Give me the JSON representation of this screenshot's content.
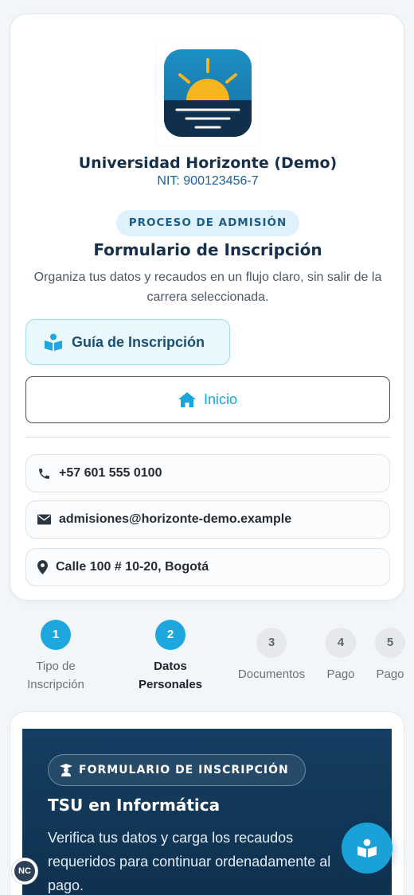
{
  "colors": {
    "accent": "#1da7de",
    "navy": "#17304a",
    "hero_bg": "#0f2f4d"
  },
  "header": {
    "university_name": "Universidad Horizonte (Demo)",
    "nit": "NIT: 900123456-7",
    "badge": "PROCESO DE ADMISIÓN",
    "form_title": "Formulario de Inscripción",
    "form_subtitle": "Organiza tus datos y recaudos en un flujo claro, sin salir de la carrera seleccionada."
  },
  "actions": {
    "guide_label": "Guía de Inscripción",
    "guide_icon": "book-reader-icon",
    "home_label": "Inicio",
    "home_icon": "home-icon"
  },
  "contact": [
    {
      "icon": "phone-icon",
      "text": "+57 601 555 0100"
    },
    {
      "icon": "envelope-icon",
      "text": "admisiones@horizonte-demo.example"
    },
    {
      "icon": "map-pin-icon",
      "text": "Calle 100 # 10-20, Bogotá"
    }
  ],
  "steps": [
    {
      "number": "1",
      "label": "Tipo de Inscripción",
      "state": "done"
    },
    {
      "number": "2",
      "label": "Datos Personales",
      "state": "current"
    },
    {
      "number": "3",
      "label": "Documentos",
      "state": "pending"
    },
    {
      "number": "4",
      "label": "Pago",
      "state": "pending"
    },
    {
      "number": "5",
      "label": "Pago",
      "state": "pending"
    }
  ],
  "hero": {
    "badge_icon": "graduate-icon",
    "badge": "FORMULARIO DE INSCRIPCIÓN",
    "career": "TSU en Informática",
    "description": "Verifica tus datos y carga los recaudos requeridos para continuar ordenadamente al pago."
  },
  "fab": {
    "icon": "book-reader-icon"
  },
  "corner_badge": {
    "text": "NC"
  }
}
